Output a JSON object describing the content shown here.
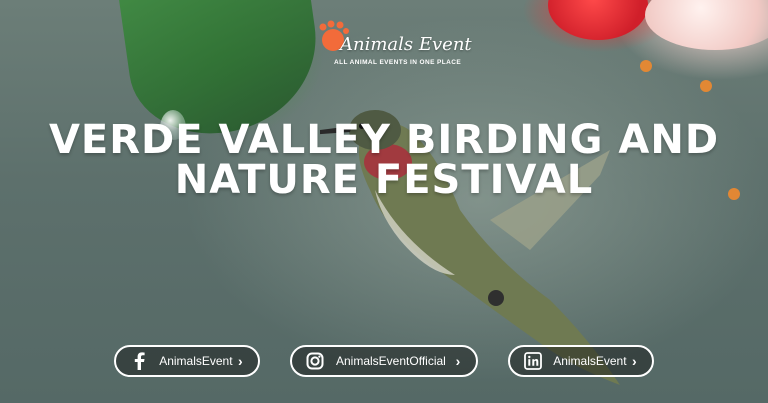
{
  "logo": {
    "name": "Animals Event",
    "tagline": "ALL ANIMAL EVENTS IN ONE PLACE"
  },
  "title": {
    "line1": "VERDE VALLEY BIRDING AND",
    "line2": "NATURE FESTIVAL"
  },
  "social": [
    {
      "platform_icon": "facebook-icon",
      "handle": "AnimalsEvent"
    },
    {
      "platform_icon": "instagram-icon",
      "handle": "AnimalsEventOfficial"
    },
    {
      "platform_icon": "linkedin-icon",
      "handle": "AnimalsEvent"
    }
  ],
  "colors": {
    "logo_accent": "#f26b3a",
    "text": "#ffffff",
    "background": "#5f7470"
  }
}
